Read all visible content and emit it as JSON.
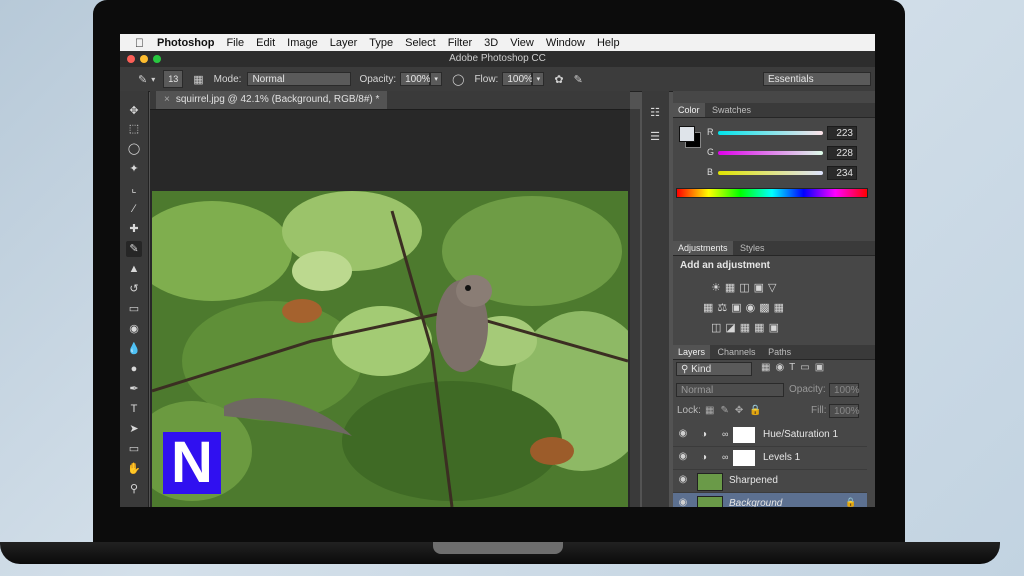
{
  "menubar": {
    "app": "Photoshop",
    "items": [
      "File",
      "Edit",
      "Image",
      "Layer",
      "Type",
      "Select",
      "Filter",
      "3D",
      "View",
      "Window",
      "Help"
    ]
  },
  "window": {
    "title": "Adobe Photoshop CC"
  },
  "options": {
    "brush_size": "13",
    "mode_label": "Mode:",
    "mode_value": "Normal",
    "opacity_label": "Opacity:",
    "opacity_value": "100%",
    "flow_label": "Flow:",
    "flow_value": "100%",
    "workspace": "Essentials"
  },
  "document": {
    "tab_title": "squirrel.jpg @ 42.1% (Background, RGB/8#) *"
  },
  "color_panel": {
    "tabs": [
      "Color",
      "Swatches"
    ],
    "r_label": "R",
    "r_value": "223",
    "g_label": "G",
    "g_value": "228",
    "b_label": "B",
    "b_value": "234"
  },
  "adjustments_panel": {
    "tabs": [
      "Adjustments",
      "Styles"
    ],
    "heading": "Add an adjustment"
  },
  "layers_panel": {
    "tabs": [
      "Layers",
      "Channels",
      "Paths"
    ],
    "kind_label": "Kind",
    "blend_mode": "Normal",
    "opacity_label": "Opacity:",
    "opacity_value": "100%",
    "lock_label": "Lock:",
    "fill_label": "Fill:",
    "fill_value": "100%",
    "layers": [
      {
        "name": "Hue/Saturation 1"
      },
      {
        "name": "Levels 1"
      },
      {
        "name": "Sharpened"
      },
      {
        "name": "Background"
      }
    ]
  },
  "watermark": {
    "letter": "N"
  },
  "colors": {
    "selected_layer": "#5c7090",
    "watermark": "#3010f0"
  }
}
